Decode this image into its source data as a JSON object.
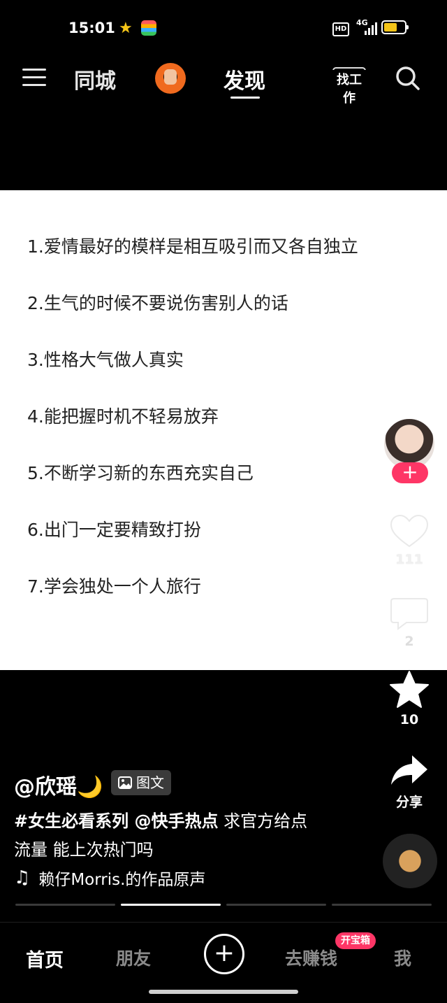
{
  "status_bar": {
    "time": "15:01",
    "network": "4G",
    "battery_percent": 55
  },
  "top_nav": {
    "tab_local": "同城",
    "tab_discover": "发现",
    "job_label": "找工作"
  },
  "post": {
    "items": [
      "1.爱情最好的模样是相互吸引而又各自独立",
      "2.生气的时候不要说伤害别人的话",
      "3.性格大气做人真实",
      "4.能把握时机不轻易放弃",
      "5.不断学习新的东西充实自己",
      "6.出门一定要精致打扮",
      "7.学会独处一个人旅行"
    ],
    "author": "@欣瑶🌙",
    "type_badge": "图文",
    "hashtags": "#女生必看系列 @快手热点",
    "desc_line1": " 求官方给点",
    "desc_line2": "流量 能上次热门吗",
    "music": "赖仔Morris.的作品原声",
    "pages_total": 4,
    "page_current": 2
  },
  "actions": {
    "follow_label": "+",
    "likes": "111",
    "comments": "2",
    "favorites": "10",
    "share_label": "分享"
  },
  "bottom_nav": {
    "home": "首页",
    "friends": "朋友",
    "earn": "去赚钱",
    "earn_badge": "开宝箱",
    "me": "我"
  },
  "colors": {
    "accent": "#fe3666",
    "star": "#f5c518",
    "battery": "#f5c518"
  }
}
